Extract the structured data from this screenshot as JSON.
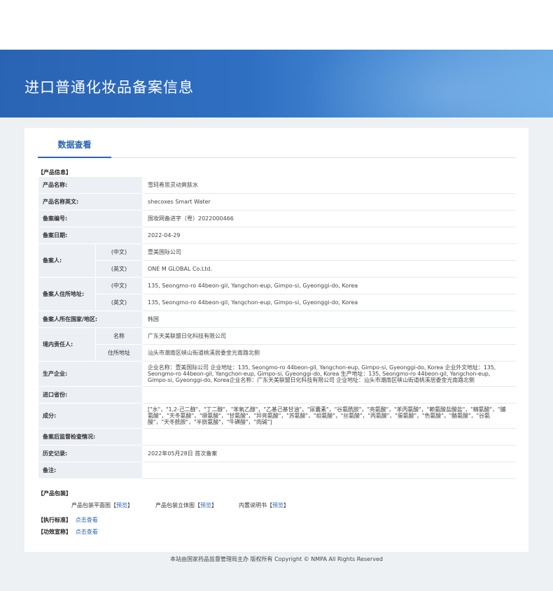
{
  "banner": {
    "title": "进口普通化妆品备案信息"
  },
  "tabs": {
    "active_label": "数据查看"
  },
  "product_info": {
    "section_label": "【产品信息】",
    "rows": {
      "product_name": {
        "key": "产品名称:",
        "value": "雪珂希思灵动爽肤水"
      },
      "product_name_en": {
        "key": "产品名称英文:",
        "value": "shecoxes Smart Water"
      },
      "record_no": {
        "key": "备案编号:",
        "value": "国妆网备进字（粤）2022000466"
      },
      "record_date": {
        "key": "备案日期:",
        "value": "2022-04-29"
      },
      "registrant": {
        "key": "备案人:",
        "sub_cn": "(中文)",
        "value_cn": "壹美国际公司",
        "sub_en": "(英文)",
        "value_en": "ONE M GLOBAL Co.Ltd."
      },
      "registrant_address": {
        "key": "备案人住所地址:",
        "sub_cn": "(中文)",
        "value_cn": "135, Seongmo-ro 44beon-gil, Yangchon-eup, Gimpo-si, Gyeonggi-do, Korea",
        "sub_en": "(英文)",
        "value_en": "135, Seongmo-ro 44beon-gil, Yangchon-eup, Gimpo-si, Gyeonggi-do, Korea"
      },
      "registrant_country": {
        "key": "备案人所在国家/地区:",
        "value": "韩国"
      },
      "domestic_agent": {
        "key": "境内责任人:",
        "sub_name": "名称",
        "value_name": "广东天美联盟日化科技有限公司",
        "sub_addr": "住所地址",
        "value_addr": "汕头市潮南区峡山街道桃溪居委金光南路北侧"
      },
      "manufacturer": {
        "key": "生产企业:",
        "value": "企业名称：壹美国际公司 企业地址：135, Seongmo-ro 44beon-gil, Yangchon-eup, Gimpo-si, Gyeonggi-do, Korea 企业外文地址：135, Seongmo-ro 44beon-gil, Yangchon-eup, Gimpo-si, Gyeonggi-do, Korea 生产地址：135, Seongmo-ro 44beon-gil, Yangchon-eup, Gimpo-si, Gyeonggi-do, Korea企业名称：广东天美联盟日化科技有限公司 企业地址：汕头市潮南区峡山街道桃溪居委金光南路北侧"
      },
      "import_destination": {
        "key": "进口省份:",
        "value": ""
      },
      "ingredients": {
        "key": "成分:",
        "value": "[\"水\"，\"1,2-己二醇\"，\"丁二醇\"，\"苯氧乙醇\"，\"乙基己基甘油\"，\"尿囊素\"，\"谷氨酰胺\"，\"亮氨酸\"，\"苯丙氨酸\"，\"赖氨酸盐酸盐\"，\"精氨酸\"，\"脯氨酸\"，\"天冬氨酸\"，\"缬氨酸\"，\"甘氨酸\"，\"异亮氨酸\"，\"苏氨酸\"，\"组氨酸\"，\"丝氨酸\"，\"丙氨酸\"，\"蛋氨酸\"，\"色氨酸\"，\"酪氨酸\"，\"谷氨酸\"，\"天冬酰胺\"，\"半胱氨酸\"，\"牛磺酸\"，\"肉碱\"]"
      },
      "post_check": {
        "key": "备案后监督检查情况:",
        "value": ""
      },
      "history": {
        "key": "历史记录:",
        "value": "2022年05月28日 首次备案"
      },
      "remarks": {
        "key": "备注:",
        "value": ""
      }
    }
  },
  "packaging": {
    "section_label": "【产品包装】",
    "flat_label": "产品包装平面图",
    "stereo_label": "产品包装立体图",
    "manual_label": "内置说明书",
    "bracket_open": "【",
    "bracket_close": "】",
    "preview_link": "预览"
  },
  "standard": {
    "section_label": "【执行标准】",
    "link": "点击查看"
  },
  "efficacy": {
    "section_label": "【功效宣称】",
    "link": "点击查看"
  },
  "footer": {
    "text": "本站由国家药品监督管理局主办 版权所有 Copyright © NMPA All Rights Reserved"
  },
  "colors": {
    "banner": "#2f6fc2",
    "accent": "#2a63b3",
    "key_cell_bg": "#ecf0f5",
    "page_bg": "#eef1f4"
  }
}
